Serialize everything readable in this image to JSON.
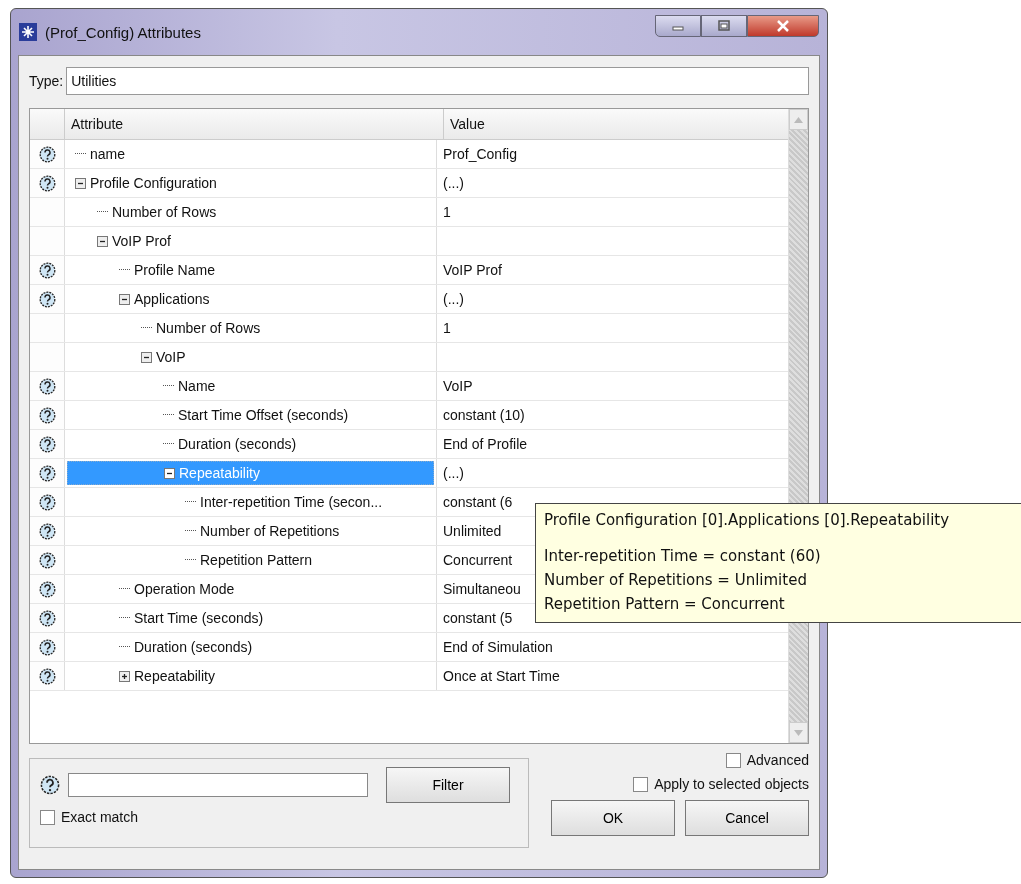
{
  "window": {
    "title": "(Prof_Config) Attributes"
  },
  "type_field": {
    "label": "Type:",
    "value": "Utilities"
  },
  "table": {
    "columns": [
      "Attribute",
      "Value"
    ],
    "tree": [
      {
        "attribute": "name",
        "value": "Prof_Config",
        "help": true,
        "selected": false
      },
      {
        "attribute": "Profile Configuration",
        "value": "(...)",
        "help": true,
        "selected": false,
        "expanded": true,
        "children": [
          {
            "attribute": "Number of Rows",
            "value": "1",
            "help": false,
            "selected": false
          },
          {
            "attribute": "VoIP Prof",
            "help": false,
            "selected": false,
            "expanded": true,
            "children": [
              {
                "attribute": "Profile Name",
                "value": "VoIP Prof",
                "help": true,
                "selected": false
              },
              {
                "attribute": "Applications",
                "value": "(...)",
                "help": true,
                "selected": false,
                "expanded": true,
                "children": [
                  {
                    "attribute": "Number of Rows",
                    "value": "1",
                    "help": false,
                    "selected": false
                  },
                  {
                    "attribute": "VoIP",
                    "help": false,
                    "selected": false,
                    "expanded": true,
                    "children": [
                      {
                        "attribute": "Name",
                        "value": "VoIP",
                        "help": true,
                        "selected": false
                      },
                      {
                        "attribute": "Start Time Offset (seconds)",
                        "value": "constant (10)",
                        "help": true,
                        "selected": false
                      },
                      {
                        "attribute": "Duration (seconds)",
                        "value": "End of Profile",
                        "help": true,
                        "selected": false
                      },
                      {
                        "attribute": "Repeatability",
                        "value": "(...)",
                        "help": true,
                        "selected": true,
                        "expanded": true,
                        "children": [
                          {
                            "attribute": "Inter-repetition Time (secon...",
                            "value": "constant (6",
                            "help": true,
                            "selected": false
                          },
                          {
                            "attribute": "Number of Repetitions",
                            "value": "Unlimited",
                            "help": true,
                            "selected": false
                          },
                          {
                            "attribute": "Repetition Pattern",
                            "value": "Concurrent",
                            "help": true,
                            "selected": false
                          }
                        ]
                      }
                    ]
                  }
                ]
              },
              {
                "attribute": "Operation Mode",
                "value": "Simultaneou",
                "help": true,
                "selected": false
              },
              {
                "attribute": "Start Time (seconds)",
                "value": "constant (5",
                "help": true,
                "selected": false
              },
              {
                "attribute": "Duration (seconds)",
                "value": "End of Simulation",
                "help": true,
                "selected": false
              },
              {
                "attribute": "Repeatability",
                "value": "Once at Start Time",
                "help": true,
                "selected": false,
                "expanded": false
              }
            ]
          }
        ]
      }
    ]
  },
  "tooltip": {
    "title": "Profile Configuration [0].Applications [0].Repeatability",
    "lines": [
      "Inter-repetition Time = constant (60)",
      "Number of Repetitions = Unlimited",
      "Repetition Pattern = Concurrent"
    ]
  },
  "filter": {
    "button": "Filter",
    "exact_match": {
      "label": "Exact match",
      "checked": false
    }
  },
  "options": [
    {
      "label": "Advanced",
      "checked": false
    },
    {
      "label": "Apply to selected objects",
      "checked": false
    }
  ],
  "buttons": [
    "OK",
    "Cancel"
  ]
}
